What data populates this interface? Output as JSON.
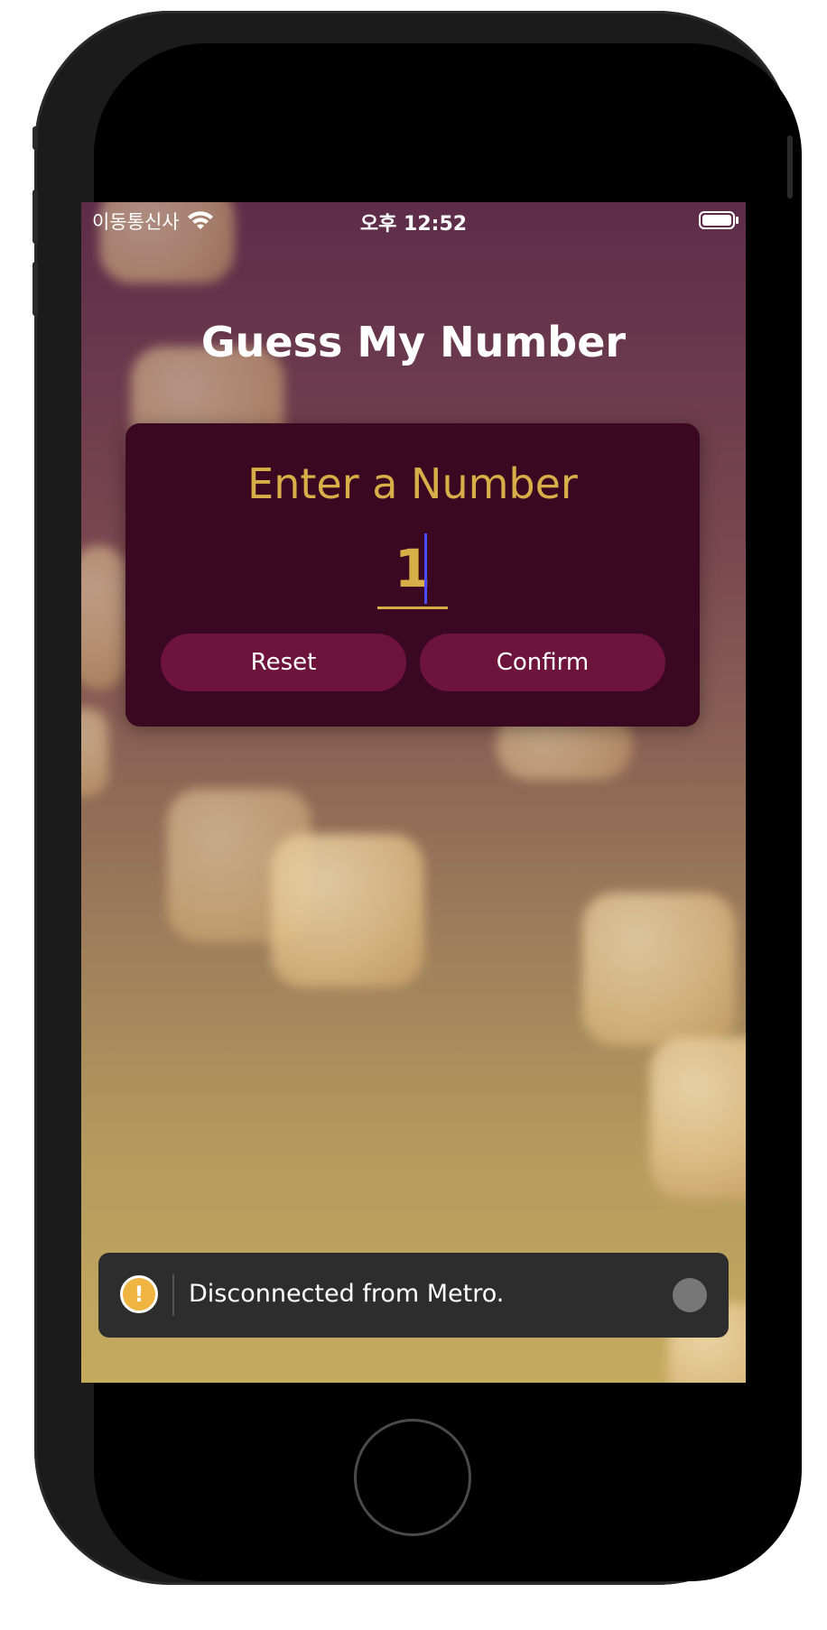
{
  "status_bar": {
    "carrier": "이동통신사",
    "time": "오후 12:52",
    "wifi_icon": "wifi-icon",
    "battery_icon": "battery-icon"
  },
  "app": {
    "title": "Guess My Number"
  },
  "card": {
    "label": "Enter a Number",
    "input_value": "1",
    "reset_label": "Reset",
    "confirm_label": "Confirm"
  },
  "toast": {
    "icon": "warning-icon",
    "icon_glyph": "!",
    "message": "Disconnected from Metro."
  },
  "colors": {
    "accent_gold": "#d8ae48",
    "card_bg": "#3a0820",
    "button_bg": "#6e143c",
    "toast_bg": "#2d2d2d",
    "warning": "#f0b440"
  }
}
